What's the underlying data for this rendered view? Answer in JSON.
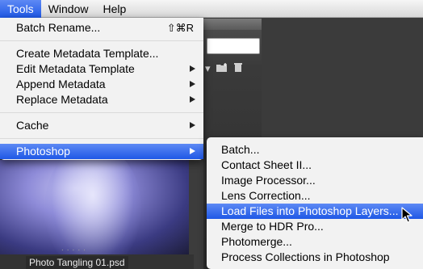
{
  "menubar": {
    "items": [
      {
        "label": "Tools"
      },
      {
        "label": "Window"
      },
      {
        "label": "Help"
      }
    ]
  },
  "tools_menu": {
    "batch_rename": {
      "label": "Batch Rename...",
      "shortcut": "⇧⌘R"
    },
    "create_metadata_template": {
      "label": "Create Metadata Template..."
    },
    "edit_metadata_template": {
      "label": "Edit Metadata Template"
    },
    "append_metadata": {
      "label": "Append Metadata"
    },
    "replace_metadata": {
      "label": "Replace Metadata"
    },
    "cache": {
      "label": "Cache"
    },
    "photoshop": {
      "label": "Photoshop"
    }
  },
  "photoshop_menu": {
    "items": [
      {
        "label": "Batch..."
      },
      {
        "label": "Contact Sheet II..."
      },
      {
        "label": "Image Processor..."
      },
      {
        "label": "Lens Correction..."
      },
      {
        "label": "Load Files into Photoshop Layers..."
      },
      {
        "label": "Merge to HDR Pro..."
      },
      {
        "label": "Photomerge..."
      },
      {
        "label": "Process Collections in Photoshop"
      }
    ]
  },
  "thumbnail": {
    "caption": "Photo Tangling 01.psd",
    "dots": "....."
  },
  "colors": {
    "highlight": "#2f67ee",
    "menu_bg": "#f6f6f6",
    "app_bg": "#3c3c3c"
  },
  "icons": [
    "new-folder-icon",
    "trash-icon",
    "dropdown-arrow-icon",
    "pointer-cursor-icon"
  ]
}
